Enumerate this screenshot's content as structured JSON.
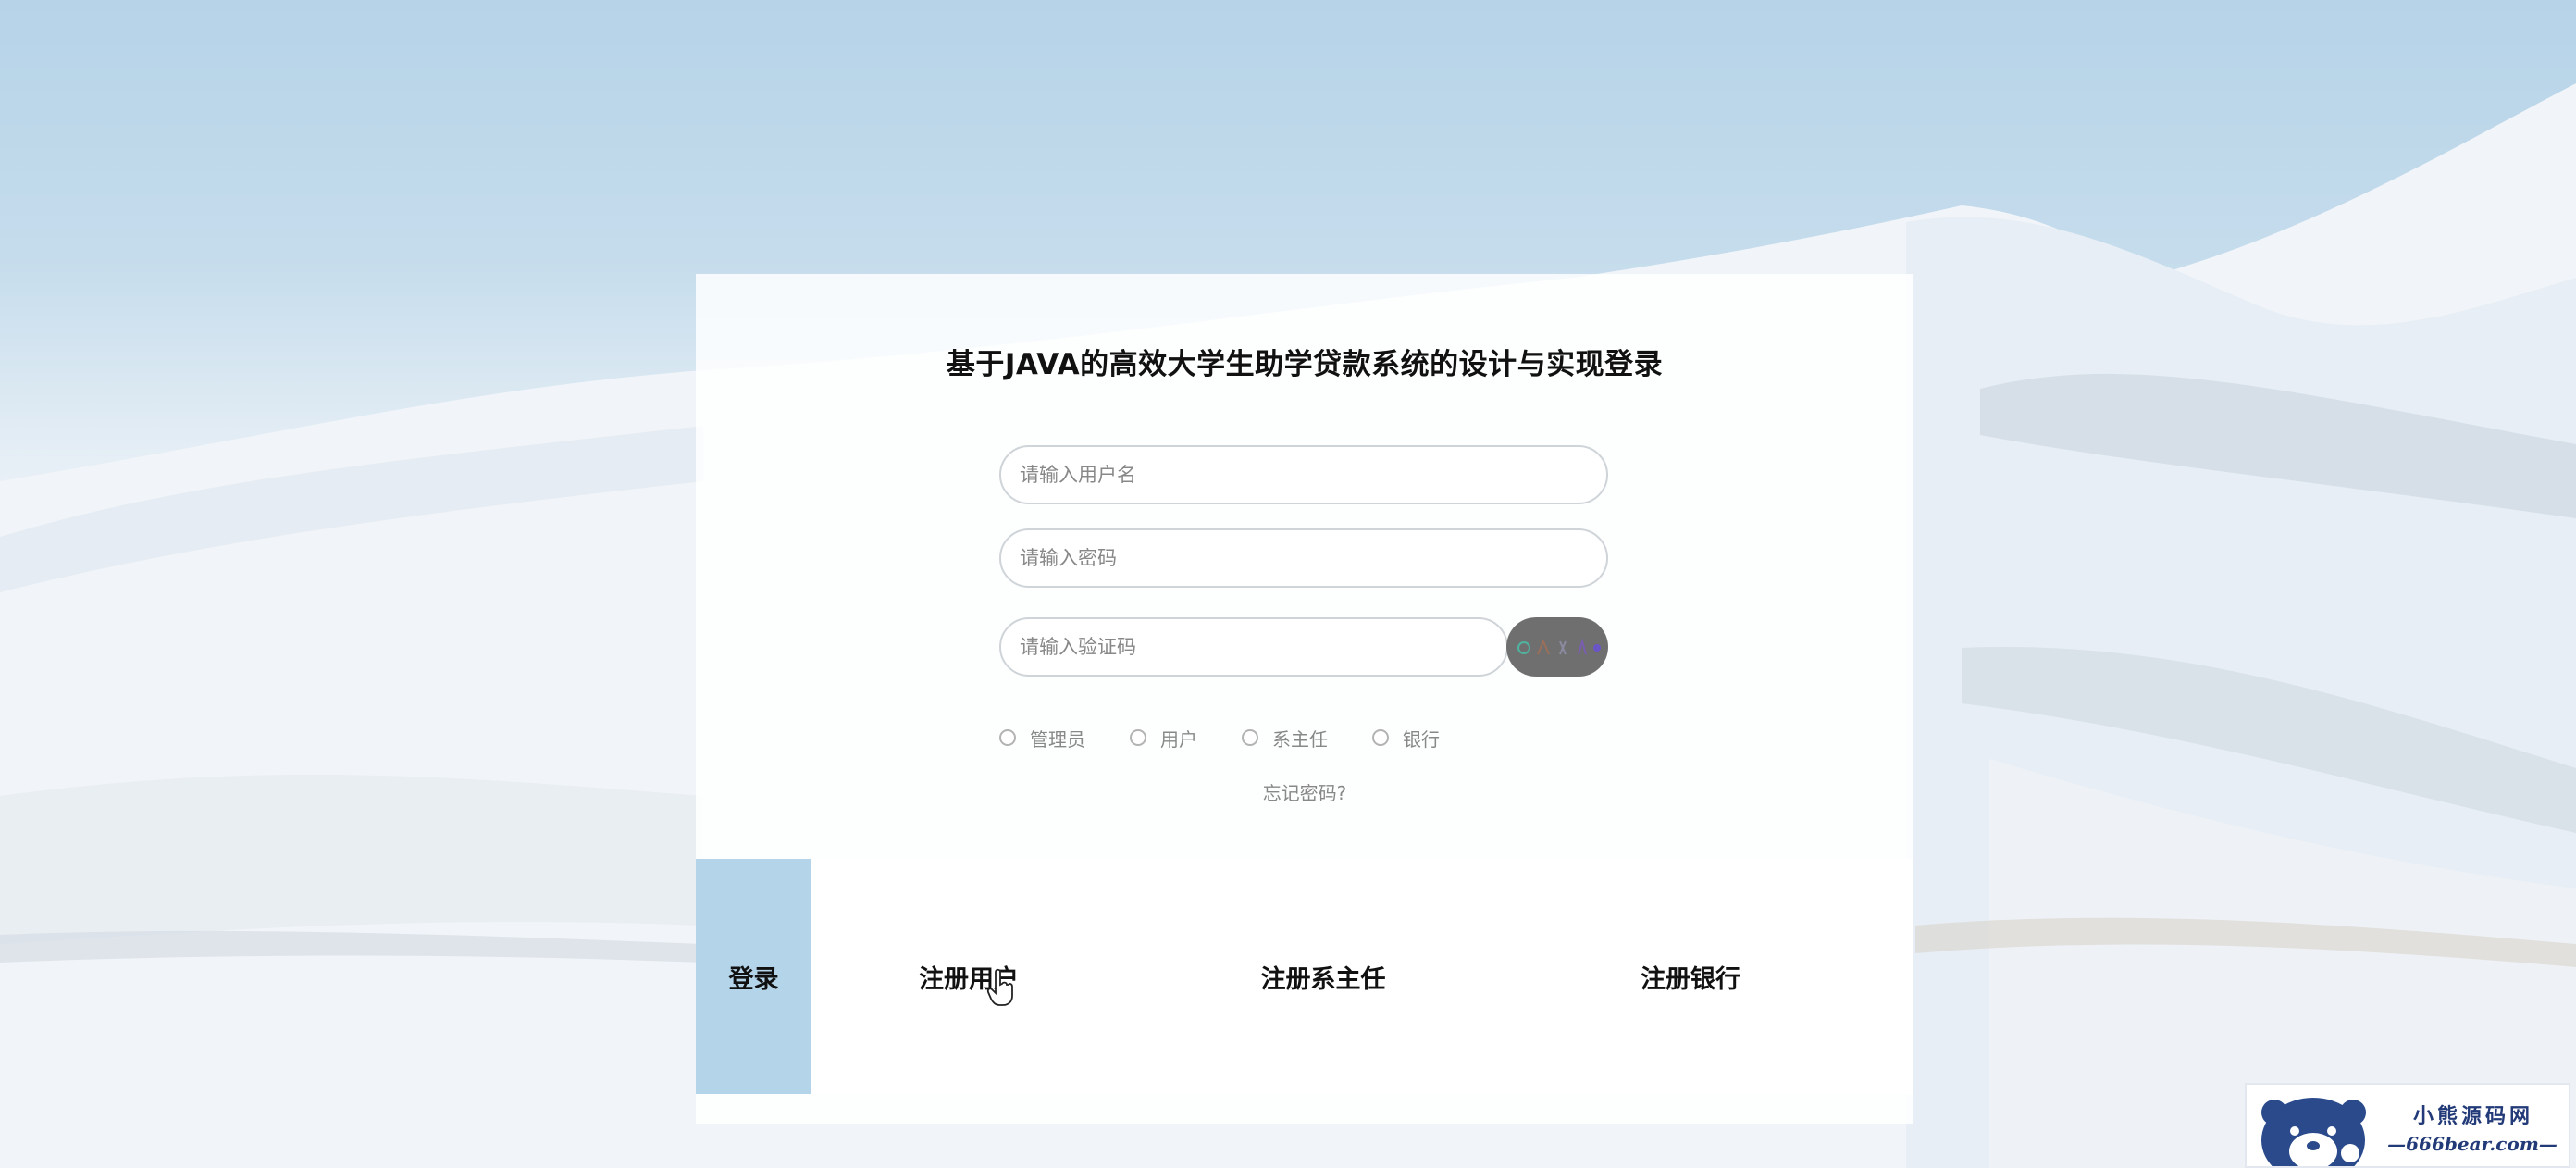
{
  "login": {
    "title": "基于JAVA的高效大学生助学贷款系统的设计与实现登录",
    "username_placeholder": "请输入用户名",
    "password_placeholder": "请输入密码",
    "captcha_placeholder": "请输入验证码",
    "roles": [
      {
        "label": "管理员"
      },
      {
        "label": "用户"
      },
      {
        "label": "系主任"
      },
      {
        "label": "银行"
      }
    ],
    "forgot_label": "忘记密码?"
  },
  "tabs": {
    "login_label": "登录",
    "register_user_label": "注册用户",
    "register_director_label": "注册系主任",
    "register_bank_label": "注册银行"
  },
  "watermark": {
    "name": "小熊源码网",
    "url": "—666bear.com—"
  },
  "colors": {
    "active_tab": "#b4d4ea",
    "captcha_bg": "#6f6f6f",
    "watermark_text": "#223a78"
  }
}
